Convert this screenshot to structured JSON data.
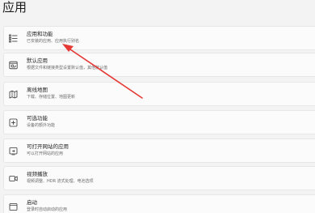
{
  "page": {
    "title": "应用"
  },
  "items": [
    {
      "icon": "apps-list-icon",
      "title": "应用和功能",
      "subtitle": "已安装的应用、应用执行别名"
    },
    {
      "icon": "default-apps-icon",
      "title": "默认应用",
      "subtitle": "根据文件和链接类型设置默认值，其他默认值"
    },
    {
      "icon": "offline-maps-icon",
      "title": "离线地图",
      "subtitle": "下载、存储位置、地图更新"
    },
    {
      "icon": "optional-features-icon",
      "title": "可选功能",
      "subtitle": "设备的额外功能"
    },
    {
      "icon": "apps-for-websites-icon",
      "title": "可打开网站的应用",
      "subtitle": "可以打开网站的应用"
    },
    {
      "icon": "video-playback-icon",
      "title": "视频播放",
      "subtitle": "视频调整、HDR 流式处理、电池选项"
    },
    {
      "icon": "startup-icon",
      "title": "启动",
      "subtitle": "登录时自动启动的应用"
    }
  ],
  "annotation": {
    "arrow_color": "#e53935"
  }
}
